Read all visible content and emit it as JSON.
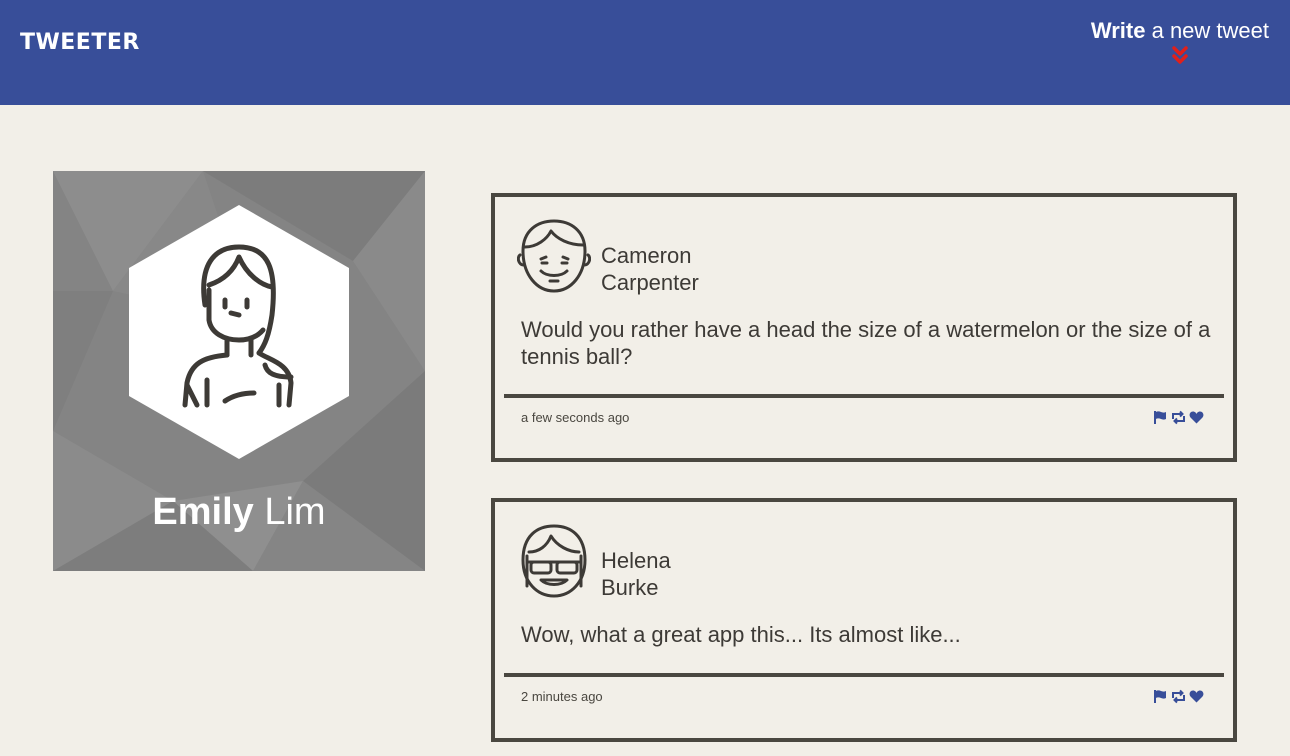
{
  "nav": {
    "logo": "TWEETER",
    "compose_strong": "Write",
    "compose_rest": "a new tweet",
    "accent_color": "#384e99",
    "chevron_color": "#e0201b",
    "chevron_icon": "double-chevron-down-icon"
  },
  "profile": {
    "first_name": "Emily",
    "last_name": "Lim",
    "avatar_icon": "woman-avatar-icon"
  },
  "tweets": [
    {
      "first_name": "Cameron",
      "last_name": "Carpenter",
      "avatar_icon": "man-avatar-icon",
      "content": "Would you rather have a head the size of a watermelon or the size of a tennis ball?",
      "timestamp": "a few seconds ago",
      "actions": [
        "flag-icon",
        "retweet-icon",
        "heart-icon"
      ]
    },
    {
      "first_name": "Helena",
      "last_name": "Burke",
      "avatar_icon": "woman-sunglasses-avatar-icon",
      "content": "Wow, what a great app this... Its almost like...",
      "timestamp": "2 minutes ago",
      "actions": [
        "flag-icon",
        "retweet-icon",
        "heart-icon"
      ]
    }
  ]
}
